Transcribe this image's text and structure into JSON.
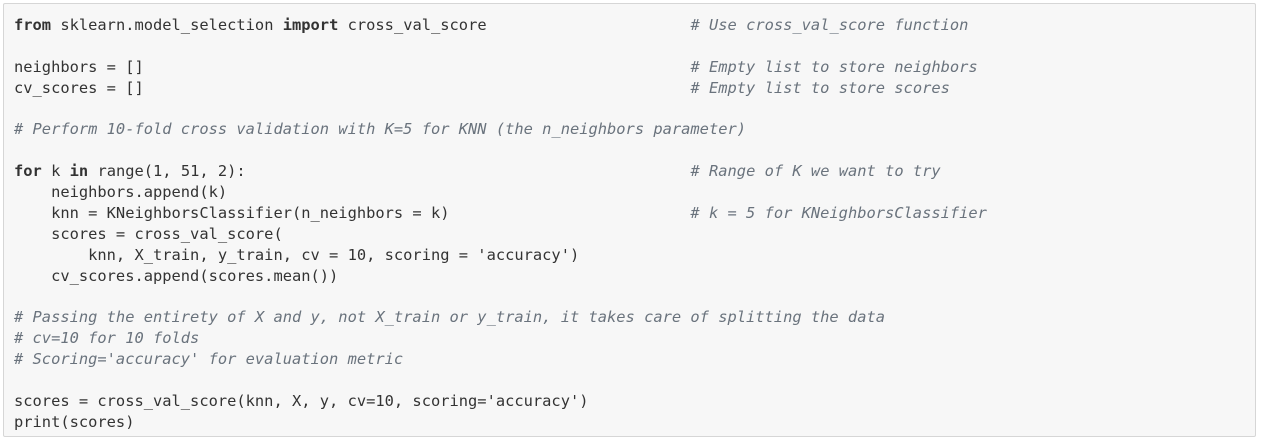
{
  "code_lines": [
    {
      "code": "",
      "segments": [
        {
          "t": "kw",
          "v": "from"
        },
        {
          "t": "tx",
          "v": " sklearn.model_selection "
        },
        {
          "t": "kw",
          "v": "import"
        },
        {
          "t": "tx",
          "v": " cross_val_score"
        }
      ],
      "comment": "# Use cross_val_score function"
    },
    {
      "segments": [],
      "comment": ""
    },
    {
      "segments": [
        {
          "t": "tx",
          "v": "neighbors = []"
        }
      ],
      "comment": "# Empty list to store neighbors"
    },
    {
      "segments": [
        {
          "t": "tx",
          "v": "cv_scores = []"
        }
      ],
      "comment": "# Empty list to store scores"
    },
    {
      "segments": [],
      "comment": ""
    },
    {
      "segments": [
        {
          "t": "cm",
          "v": "# Perform 10-fold cross validation with K=5 for KNN (the n_neighbors parameter)"
        }
      ],
      "comment": ""
    },
    {
      "segments": [],
      "comment": ""
    },
    {
      "segments": [
        {
          "t": "kw",
          "v": "for"
        },
        {
          "t": "tx",
          "v": " k "
        },
        {
          "t": "kw",
          "v": "in"
        },
        {
          "t": "tx",
          "v": " range(1, 51, 2):"
        }
      ],
      "comment": "# Range of K we want to try"
    },
    {
      "segments": [
        {
          "t": "tx",
          "v": "    neighbors.append(k)"
        }
      ],
      "comment": ""
    },
    {
      "segments": [
        {
          "t": "tx",
          "v": "    knn = KNeighborsClassifier(n_neighbors = k)"
        }
      ],
      "comment": "# k = 5 for KNeighborsClassifier"
    },
    {
      "segments": [
        {
          "t": "tx",
          "v": "    scores = cross_val_score("
        }
      ],
      "comment": ""
    },
    {
      "segments": [
        {
          "t": "tx",
          "v": "        knn, X_train, y_train, cv = 10, scoring = 'accuracy')"
        }
      ],
      "comment": ""
    },
    {
      "segments": [
        {
          "t": "tx",
          "v": "    cv_scores.append(scores.mean())"
        }
      ],
      "comment": ""
    },
    {
      "segments": [],
      "comment": ""
    },
    {
      "segments": [
        {
          "t": "cm",
          "v": "# Passing the entirety of X and y, not X_train or y_train, it takes care of splitting the data"
        }
      ],
      "comment": ""
    },
    {
      "segments": [
        {
          "t": "cm",
          "v": "# cv=10 for 10 folds"
        }
      ],
      "comment": ""
    },
    {
      "segments": [
        {
          "t": "cm",
          "v": "# Scoring='accuracy' for evaluation metric"
        }
      ],
      "comment": ""
    },
    {
      "segments": [],
      "comment": ""
    },
    {
      "segments": [
        {
          "t": "tx",
          "v": "scores = cross_val_score(knn, X, y, cv=10, scoring='accuracy')"
        }
      ],
      "comment": ""
    },
    {
      "segments": [
        {
          "t": "tx",
          "v": "print(scores)"
        }
      ],
      "comment": ""
    }
  ],
  "colors": {
    "background": "#f7f7f7",
    "border": "#d6d6d6",
    "text": "#333333",
    "comment": "#6a737d"
  }
}
